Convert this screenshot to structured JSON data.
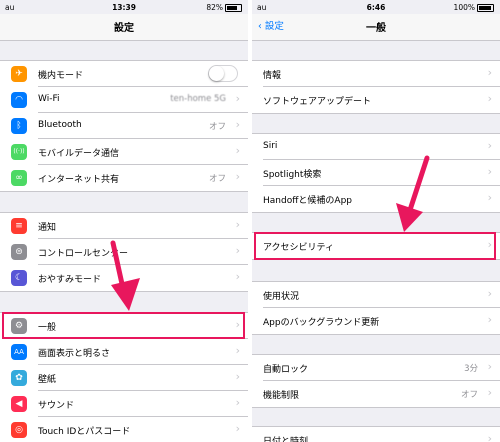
{
  "left": {
    "status": {
      "carrier": "au",
      "time": "13:39",
      "battery_pct": "82%"
    },
    "title": "設定",
    "rows": [
      {
        "label": "機内モード",
        "icon": "airplane-icon",
        "color": "#ff9500",
        "glyph": "✈",
        "toggle": true
      },
      {
        "label": "Wi-Fi",
        "icon": "wifi-icon",
        "color": "#007aff",
        "glyph": "◠",
        "value": "ten-home 5G"
      },
      {
        "label": "Bluetooth",
        "icon": "bluetooth-icon",
        "color": "#007aff",
        "glyph": "ᛒ",
        "value": "オフ"
      },
      {
        "label": "モバイルデータ通信",
        "icon": "cellular-icon",
        "color": "#4cd964",
        "glyph": "((·))"
      },
      {
        "label": "インターネット共有",
        "icon": "hotspot-icon",
        "color": "#4cd964",
        "glyph": "∞",
        "value": "オフ"
      },
      {
        "label": "通知",
        "icon": "notifications-icon",
        "color": "#ff3b30",
        "glyph": "≡"
      },
      {
        "label": "コントロールセンター",
        "icon": "control-center-icon",
        "color": "#8e8e93",
        "glyph": "⊜"
      },
      {
        "label": "おやすみモード",
        "icon": "moon-icon",
        "color": "#5856d6",
        "glyph": "☾"
      },
      {
        "label": "一般",
        "icon": "gear-icon",
        "color": "#8e8e93",
        "glyph": "⚙"
      },
      {
        "label": "画面表示と明るさ",
        "icon": "display-icon",
        "color": "#007aff",
        "glyph": "AA"
      },
      {
        "label": "壁紙",
        "icon": "wallpaper-icon",
        "color": "#34aadc",
        "glyph": "✿"
      },
      {
        "label": "サウンド",
        "icon": "sound-icon",
        "color": "#ff2d55",
        "glyph": "◀"
      },
      {
        "label": "Touch IDとパスコード",
        "icon": "fingerprint-icon",
        "color": "#ff3b30",
        "glyph": "◎"
      }
    ]
  },
  "right": {
    "status": {
      "carrier": "au",
      "time": "6:46",
      "battery_pct": "100%"
    },
    "back": "設定",
    "title": "一般",
    "rows": [
      {
        "label": "情報"
      },
      {
        "label": "ソフトウェアアップデート"
      },
      {
        "label": "Siri"
      },
      {
        "label": "Spotlight検索"
      },
      {
        "label": "Handoffと候補のApp"
      },
      {
        "label": "アクセシビリティ"
      },
      {
        "label": "使用状況"
      },
      {
        "label": "Appのバックグラウンド更新"
      },
      {
        "label": "自動ロック",
        "value": "3分"
      },
      {
        "label": "機能制限",
        "value": "オフ"
      },
      {
        "label": "日付と時刻"
      }
    ]
  },
  "colors": {
    "highlight": "#e8175d",
    "tint": "#007aff"
  }
}
